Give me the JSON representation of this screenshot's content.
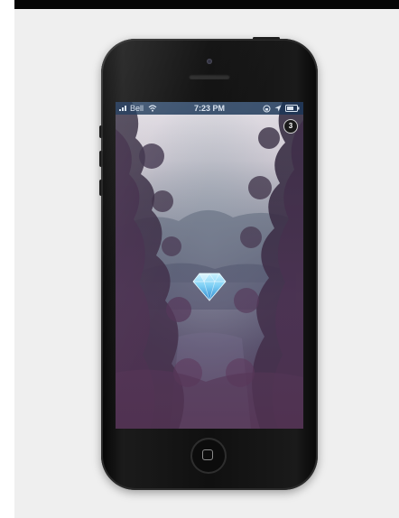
{
  "status_bar": {
    "carrier": "Bell",
    "time": "7:23 PM",
    "icons": [
      "signal-bars-icon",
      "wifi-icon",
      "rotation-lock-icon",
      "location-arrow-icon",
      "battery-icon"
    ]
  },
  "notification_badge": {
    "count": "3"
  },
  "center_icon": "diamond-icon",
  "colors": {
    "status_bar_bg": "#183456",
    "diamond_light": "#9fe3ff",
    "diamond_dark": "#2f8ad0",
    "page_bg": "#efefef"
  }
}
